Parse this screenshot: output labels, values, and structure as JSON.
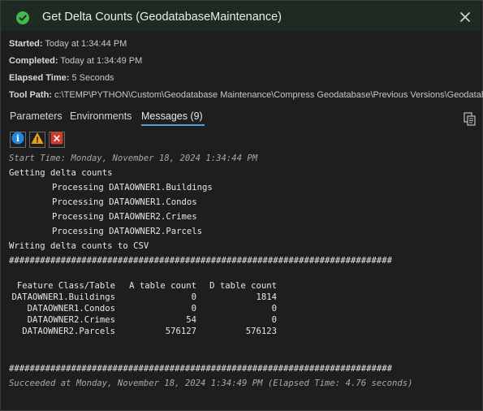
{
  "header": {
    "title": "Get Delta Counts (GeodatabaseMaintenance)",
    "status": "success"
  },
  "meta": {
    "started_label": "Started:",
    "started_value": "Today at 1:34:44 PM",
    "completed_label": "Completed:",
    "completed_value": "Today at 1:34:49 PM",
    "elapsed_label": "Elapsed Time:",
    "elapsed_value": "5 Seconds",
    "toolpath_label": "Tool Path:",
    "toolpath_value": "c:\\TEMP\\PYTHON\\Custom\\Geodatabase Maintenance\\Compress Geodatabase\\Previous Versions\\Geodatabas"
  },
  "tabs": {
    "parameters": "Parameters",
    "environments": "Environments",
    "messages": "Messages (9)",
    "active": "messages"
  },
  "filters": {
    "info": "i",
    "warning": "!",
    "error": "×"
  },
  "colors": {
    "success": "#3fb950",
    "accent": "#4f9fe0",
    "info": "#1e88e5",
    "warning": "#e6a117",
    "error": "#d13a2f"
  },
  "messages": {
    "start_time": "Start Time: Monday, November 18, 2024 1:34:44 PM",
    "getting": "Getting delta counts",
    "processing": [
      "Processing DATAOWNER1.Buildings",
      "Processing DATAOWNER1.Condos",
      "Processing DATAOWNER2.Crimes",
      "Processing DATAOWNER2.Parcels"
    ],
    "writing": "Writing delta counts to CSV",
    "separator": "##########################################################################",
    "table": {
      "headers": [
        "Feature Class/Table",
        "A table count",
        "D table count"
      ],
      "rows": [
        [
          "DATAOWNER1.Buildings",
          "0",
          "1814"
        ],
        [
          "DATAOWNER1.Condos",
          "0",
          "0"
        ],
        [
          "DATAOWNER2.Crimes",
          "54",
          "0"
        ],
        [
          "DATAOWNER2.Parcels",
          "576127",
          "576123"
        ]
      ]
    },
    "separator2": "##########################################################################",
    "succeeded": "Succeeded at Monday, November 18, 2024 1:34:49 PM (Elapsed Time: 4.76 seconds)"
  }
}
